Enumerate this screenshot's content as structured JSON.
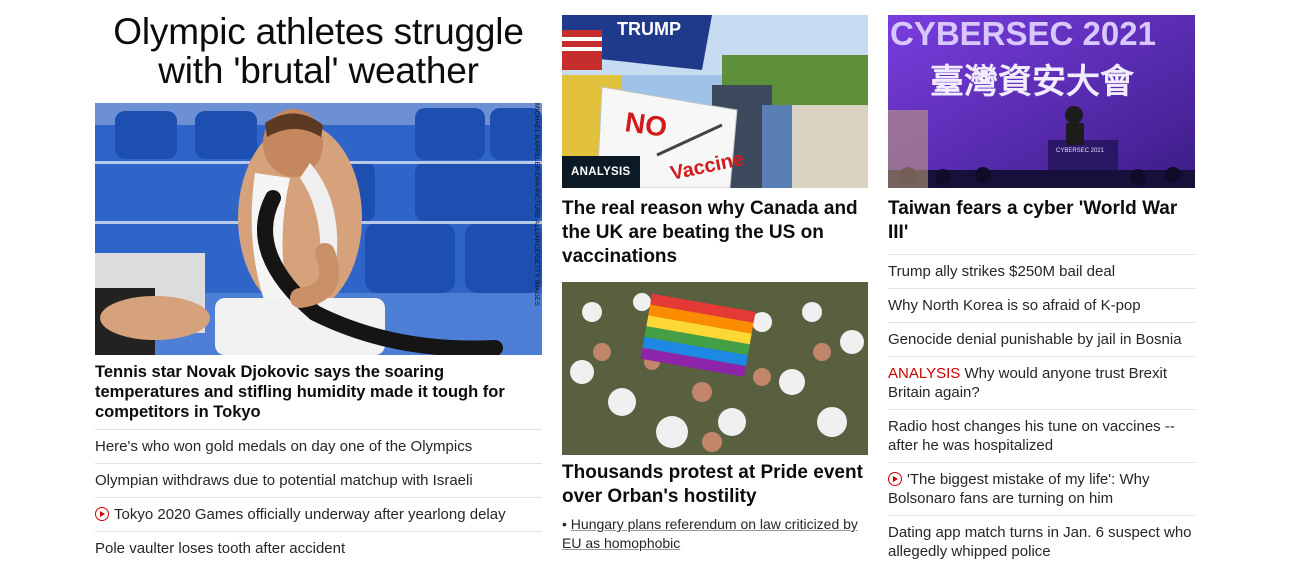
{
  "col1": {
    "headline": "Olympic athletes struggle with 'brutal' weather",
    "photo_credit": "MICHAEL KAPPELER/DPA/PICTURE ALLIANCE/GETTY IMAGES",
    "caption": "Tennis star Novak Djokovic says the soaring temperatures and stifling humidity made it tough for competitors in Tokyo",
    "links": [
      {
        "text": "Here's who won gold medals on day one of the Olympics",
        "video": false
      },
      {
        "text": "Olympian withdraws due to potential matchup with Israeli",
        "video": false
      },
      {
        "text": "Tokyo 2020 Games officially underway after yearlong delay",
        "video": true
      },
      {
        "text": "Pole vaulter loses tooth after accident",
        "video": false
      }
    ]
  },
  "col2": {
    "top_story": {
      "badge": "ANALYSIS",
      "sign_no": "NO",
      "sign_vaccine": "Vaccine",
      "flag_text": "TRUMP",
      "headline": "The real reason why Canada and the UK are beating the US on vaccinations"
    },
    "second_story": {
      "headline": "Thousands protest at Pride event over Orban's hostility",
      "sublink": "Hungary plans referendum on law criticized by EU as homophobic"
    }
  },
  "col3": {
    "top_story": {
      "banner_line1": "CYBERSEC 2021",
      "banner_line2": "臺灣資安大會",
      "podium_text": "CYBERSEC 2021",
      "headline": "Taiwan fears a cyber 'World War III'"
    },
    "links": [
      {
        "prefix": "",
        "text": "Trump ally strikes $250M bail deal",
        "video": false
      },
      {
        "prefix": "",
        "text": "Why North Korea is so afraid of K-pop",
        "video": false
      },
      {
        "prefix": "",
        "text": "Genocide denial punishable by jail in Bosnia",
        "video": false
      },
      {
        "prefix": "ANALYSIS",
        "text": "Why would anyone trust Brexit Britain again?",
        "video": false
      },
      {
        "prefix": "",
        "text": "Radio host changes his tune on vaccines -- after he was hospitalized",
        "video": false
      },
      {
        "prefix": "",
        "text": "'The biggest mistake of my life': Why Bolsonaro fans are turning on him",
        "video": true
      },
      {
        "prefix": "",
        "text": "Dating app match turns in Jan. 6 suspect who allegedly whipped police",
        "video": false
      }
    ]
  }
}
